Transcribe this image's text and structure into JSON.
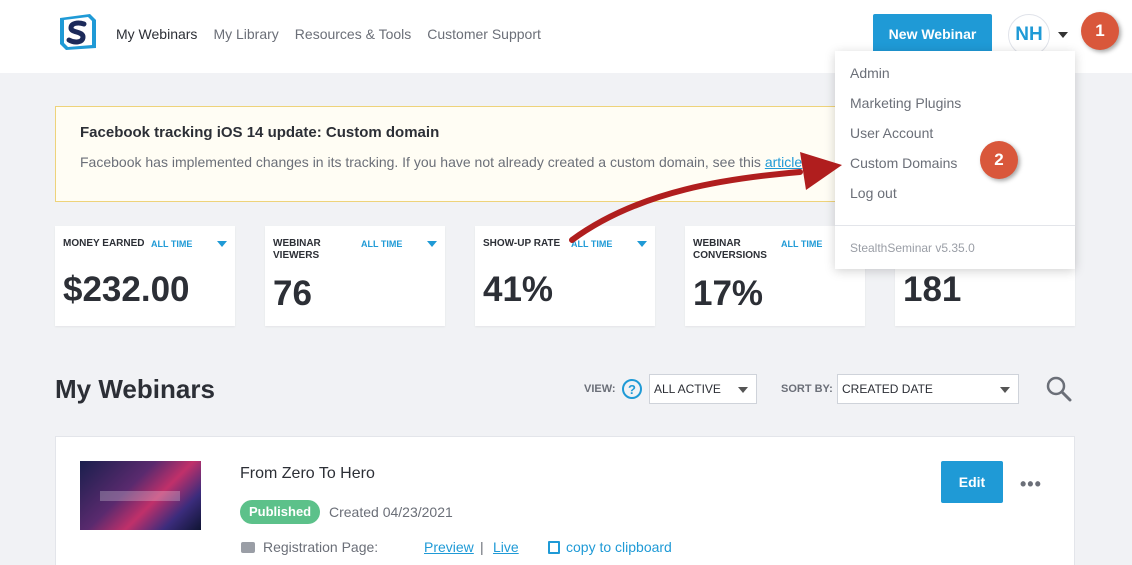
{
  "header": {
    "nav": [
      "My Webinars",
      "My Library",
      "Resources & Tools",
      "Customer Support"
    ],
    "new_webinar_label": "New Webinar",
    "avatar_initials": "NH"
  },
  "callouts": [
    "1",
    "2"
  ],
  "alert": {
    "title": "Facebook tracking iOS 14 update: Custom domain",
    "body": "Facebook has implemented changes in its tracking. If you have not already created a custom domain, see this ",
    "link": "article"
  },
  "stats": [
    {
      "label": "MONEY EARNED",
      "period": "ALL TIME",
      "value": "$232.00"
    },
    {
      "label": "WEBINAR VIEWERS",
      "period": "ALL TIME",
      "value": "76"
    },
    {
      "label": "SHOW-UP RATE",
      "period": "ALL TIME",
      "value": "41%"
    },
    {
      "label": "WEBINAR CONVERSIONS",
      "period": "ALL TIME",
      "value": "17%"
    },
    {
      "label": "",
      "period": "",
      "value": "181"
    }
  ],
  "user_menu": {
    "items": [
      "Admin",
      "Marketing Plugins",
      "User Account",
      "Custom Domains",
      "Log out"
    ],
    "version": "StealthSeminar v5.35.0"
  },
  "webinars_section": {
    "title": "My Webinars",
    "view_label": "VIEW:",
    "help_icon_text": "?",
    "view_value": "ALL ACTIVE",
    "sort_label": "SORT BY:",
    "sort_value": "CREATED DATE"
  },
  "webinar": {
    "title": "From Zero To Hero",
    "status": "Published",
    "created": "Created 04/23/2021",
    "reg_label": "Registration Page:",
    "preview": "Preview",
    "separator": "|",
    "live": "Live",
    "copy": "copy to clipboard",
    "edit": "Edit",
    "more": "•••"
  },
  "colors": {
    "accent": "#1f9ad6",
    "callout": "#d9573b",
    "published": "#5cc18a",
    "arrow": "#b01e1e"
  },
  "icons": [
    "logo-icon",
    "caret-down-icon",
    "help-icon",
    "search-icon",
    "ticket-icon",
    "copy-icon",
    "more-icon"
  ]
}
